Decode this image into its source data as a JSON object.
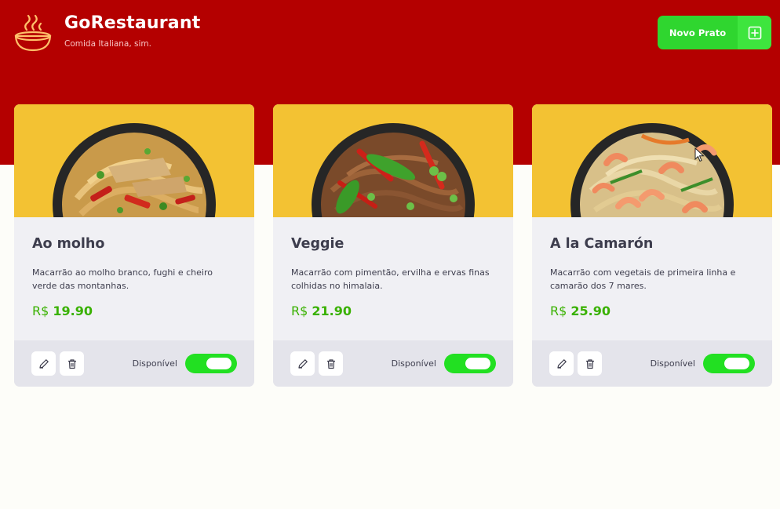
{
  "header": {
    "title": "GoRestaurant",
    "subtitle": "Comida Italiana, sim.",
    "new_button_label": "Novo Prato"
  },
  "foods": [
    {
      "name": "Ao molho",
      "description": "Macarrão ao molho branco, fughi e cheiro verde das montanhas.",
      "currency": "R$",
      "price": "19.90",
      "available_label": "Disponível",
      "available": true
    },
    {
      "name": "Veggie",
      "description": "Macarrão com pimentão, ervilha e ervas finas colhidas no himalaia.",
      "currency": "R$",
      "price": "21.90",
      "available_label": "Disponível",
      "available": true
    },
    {
      "name": "A la Camarón",
      "description": "Macarrão com vegetais de primeira linha e camarão dos 7 mares.",
      "currency": "R$",
      "price": "25.90",
      "available_label": "Disponível",
      "available": true
    }
  ],
  "colors": {
    "header_red": "#b40000",
    "accent_green": "#39b100",
    "button_green": "#2fd62f",
    "card_image_bg": "#f3c233"
  },
  "icons": {
    "logo": "steaming-bowl-icon",
    "new_button": "plus-square-icon",
    "edit": "pencil-icon",
    "delete": "trash-icon"
  }
}
